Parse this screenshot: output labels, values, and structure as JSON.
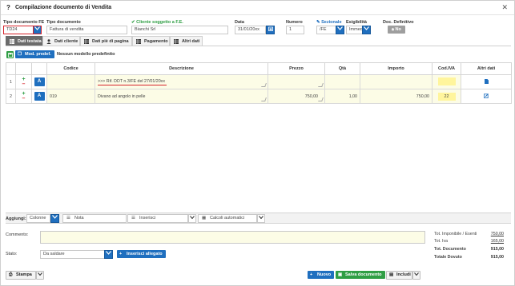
{
  "window": {
    "help": "?",
    "title": "Compilazione documento di Vendita",
    "close": "✕"
  },
  "header": {
    "tipo_documento_fe": {
      "label": "Tipo documento FE",
      "value": "TD24"
    },
    "tipo_documento": {
      "label": "Tipo documento",
      "value": "Fattura di vendita"
    },
    "cliente": {
      "label": "Cliente soggetto a F.E.",
      "value": "Bianchi Srl"
    },
    "data": {
      "label": "Data",
      "value": "31/01/20xx"
    },
    "numero": {
      "label": "Numero",
      "value": "1"
    },
    "sezionale": {
      "label": "Sezionale",
      "value": "/FE"
    },
    "esigibilita": {
      "label": "Esigibilità",
      "value": "Immed"
    },
    "doc_definitivo": {
      "label": "Doc. Definitivo",
      "value": "No"
    }
  },
  "tabs": [
    "Dati testata",
    "Dati cliente",
    "Dati piè di pagina",
    "Pagamento",
    "Altri dati"
  ],
  "toolbar": {
    "mod_label": "Mod. predef.",
    "info": "Nessun modello predefinito"
  },
  "table": {
    "headers": [
      "Codice",
      "Descrizione",
      "Prezzo",
      "Qtà",
      "Importo",
      "Cod.IVA",
      "Altri dati"
    ],
    "rows": [
      {
        "num": "1",
        "codice": "",
        "descrizione": ">>> Rif. DDT n.3/FE del 27/01/20xx",
        "prezzo": "",
        "qta": "",
        "importo": "",
        "cod_iva": ""
      },
      {
        "num": "2",
        "codice": "019",
        "descrizione": "Divano ad angolo in pelle",
        "prezzo": "750,00",
        "qta": "1,00",
        "importo": "750,00",
        "cod_iva": "22"
      }
    ]
  },
  "bottom_toolbar": {
    "aggiungi": "Aggiungi:",
    "colonne": "Colonne",
    "nota": "Nota",
    "inserisci": "Inserisci",
    "calcoli": "Calcoli automatici"
  },
  "commento": {
    "label": "Commento:",
    "value": ""
  },
  "stato": {
    "label": "Stato:",
    "value": "Da saldare",
    "allegato_btn": "Inserisci allegato"
  },
  "totals": [
    {
      "label": "Tot. Imponibile / Esenti",
      "value": "750,00"
    },
    {
      "label": "Tot. Iva",
      "value": "165,00"
    },
    {
      "label": "Tot. Documento",
      "value": "915,00"
    },
    {
      "label": "Totale Dovuto",
      "value": "915,00"
    }
  ],
  "footer": {
    "stampa": "Stampa",
    "nuovo": "Nuovo",
    "salva": "Salva documento",
    "includi": "Includi"
  },
  "colors": {
    "accent_blue": "#1f6fbf",
    "green": "#2f9e44",
    "red": "#d6242b",
    "row_yellow": "#fcfce6"
  }
}
